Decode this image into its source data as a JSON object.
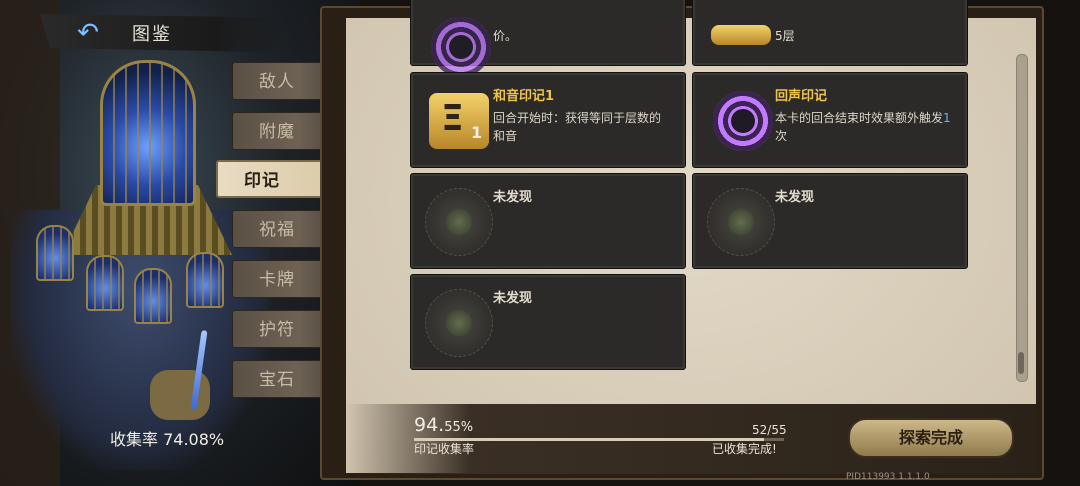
{
  "header": {
    "back_icon": "↶",
    "title": "图鉴"
  },
  "tabs": [
    {
      "label": "敌人",
      "active": false
    },
    {
      "label": "附魔",
      "active": false
    },
    {
      "label": "印记",
      "active": true
    },
    {
      "label": "祝福",
      "active": false
    },
    {
      "label": "卡牌",
      "active": false
    },
    {
      "label": "护符",
      "active": false
    },
    {
      "label": "宝石",
      "active": false
    }
  ],
  "overall": {
    "label": "收集率",
    "value": "74.08%"
  },
  "cards_partial": {
    "left_text": "价。",
    "right_text": "5层"
  },
  "cards": [
    {
      "name": "和音印记1",
      "desc": "回合开始时：获得等同于层数的和音",
      "stack": "1",
      "icon": "harmony-seal-icon",
      "found": true
    },
    {
      "name": "回声印记",
      "desc_before": "本卡的回合结束时效果额外触发",
      "desc_hl": "1",
      "desc_after": "次",
      "icon": "echo-seal-icon",
      "found": true
    },
    {
      "name": "未发现",
      "icon": "locked-seal-icon",
      "found": false
    },
    {
      "name": "未发现",
      "icon": "locked-seal-icon",
      "found": false
    },
    {
      "name": "未发现",
      "icon": "locked-seal-icon",
      "found": false
    }
  ],
  "progress": {
    "percent_big": "94.",
    "percent_small": "55%",
    "fraction": 0.9455,
    "label": "印记收集率",
    "count": "52/55",
    "done": "已收集完成!"
  },
  "explore_button": "探索完成",
  "version": "PID113993  1.1.1.0",
  "colors": {
    "accent_gold": "#f0c44a",
    "highlight_blue": "#5fb4ff",
    "panel_bg": "#d9cfbd"
  }
}
